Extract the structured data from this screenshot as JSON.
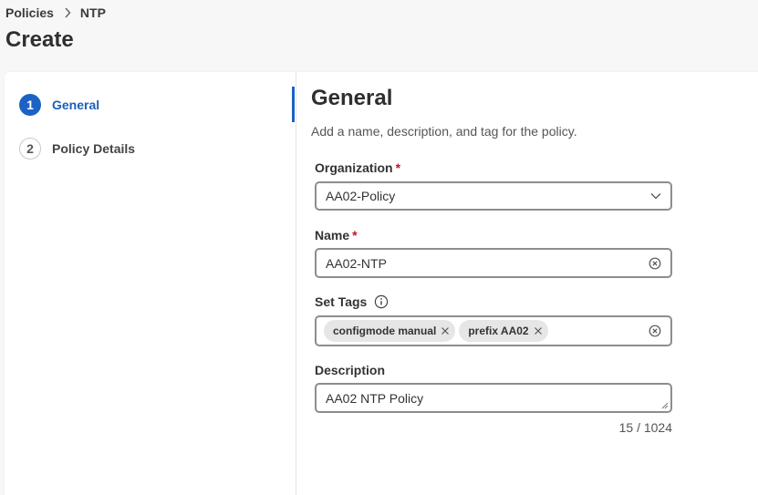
{
  "breadcrumb": {
    "items": [
      "Policies",
      "NTP"
    ]
  },
  "page": {
    "title": "Create"
  },
  "steps": [
    {
      "number": "1",
      "label": "General",
      "state": "active"
    },
    {
      "number": "2",
      "label": "Policy Details",
      "state": "inactive"
    }
  ],
  "general": {
    "title": "General",
    "description": "Add a name, description, and tag for the policy.",
    "organization": {
      "label": "Organization",
      "required": "*",
      "value": "AA02-Policy"
    },
    "name": {
      "label": "Name",
      "required": "*",
      "value": "AA02-NTP"
    },
    "tags": {
      "label": "Set Tags",
      "chips": [
        "configmode manual",
        "prefix AA02"
      ]
    },
    "description_field": {
      "label": "Description",
      "value": "AA02 NTP Policy",
      "counter": "15 / 1024"
    }
  },
  "colors": {
    "accent": "#1b62c4",
    "required": "#c8102e",
    "border": "#8d8d8d"
  }
}
